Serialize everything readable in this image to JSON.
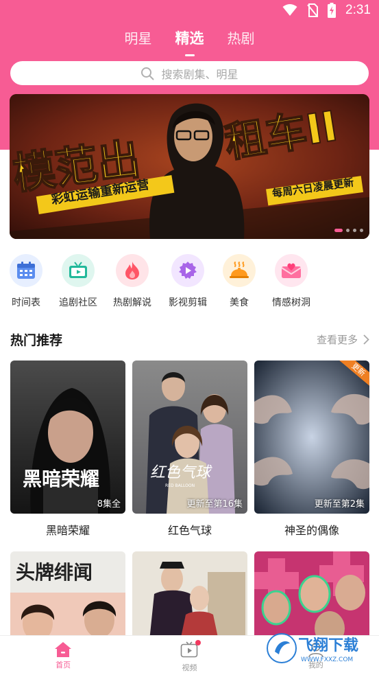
{
  "status_bar": {
    "time": "2:31"
  },
  "top_tabs": [
    {
      "label": "明星",
      "active": false
    },
    {
      "label": "精选",
      "active": true
    },
    {
      "label": "热剧",
      "active": false
    }
  ],
  "search": {
    "placeholder": "搜索剧集、明星"
  },
  "banner": {
    "headline_left": "模范出",
    "headline_right": "租车II",
    "caption_left": "彩虹运输重新运营",
    "caption_right": "每周六日凌晨更新",
    "slide_count": 4,
    "active_slide": 1
  },
  "categories": [
    {
      "label": "时间表",
      "icon": "calendar-icon",
      "color": "#5b8def",
      "bg": "#e7efff"
    },
    {
      "label": "追剧社区",
      "icon": "tv-community-icon",
      "color": "#21b89a",
      "bg": "#dff6ef"
    },
    {
      "label": "热剧解说",
      "icon": "flame-icon",
      "color": "#ff5566",
      "bg": "#ffe4e8"
    },
    {
      "label": "影视剪辑",
      "icon": "play-clip-icon",
      "color": "#a865e8",
      "bg": "#f2e6ff"
    },
    {
      "label": "美食",
      "icon": "food-dish-icon",
      "color": "#ff9a1e",
      "bg": "#fff1d9"
    },
    {
      "label": "情感树洞",
      "icon": "heart-envelope-icon",
      "color": "#ff6f9f",
      "bg": "#ffe6ef"
    }
  ],
  "section": {
    "title": "热门推荐",
    "see_more": "查看更多"
  },
  "cards": [
    {
      "title": "黑暗荣耀",
      "status": "8集全",
      "poster_text": "黑暗荣耀",
      "badge": ""
    },
    {
      "title": "红色气球",
      "status": "更新至第16集",
      "poster_text": "红色气球",
      "poster_subtext": "RED BALLOON",
      "badge": ""
    },
    {
      "title": "神圣的偶像",
      "status": "更新至第2集",
      "poster_text": "",
      "badge": "更新"
    }
  ],
  "second_row": [
    {
      "poster_text": "头牌绯闻"
    },
    {
      "poster_text": ""
    },
    {
      "poster_text": ""
    }
  ],
  "bottom_nav": [
    {
      "label": "首页",
      "icon": "home-icon",
      "active": true
    },
    {
      "label": "视频",
      "icon": "video-icon",
      "active": false,
      "dot": true
    },
    {
      "label": "我的",
      "icon": "profile-icon",
      "active": false
    }
  ],
  "watermark": {
    "brand": "飞翔下载",
    "domain": "WWW.FXXZ.COM"
  },
  "colors": {
    "accent": "#f75c94",
    "badge": "#ef7f22"
  }
}
